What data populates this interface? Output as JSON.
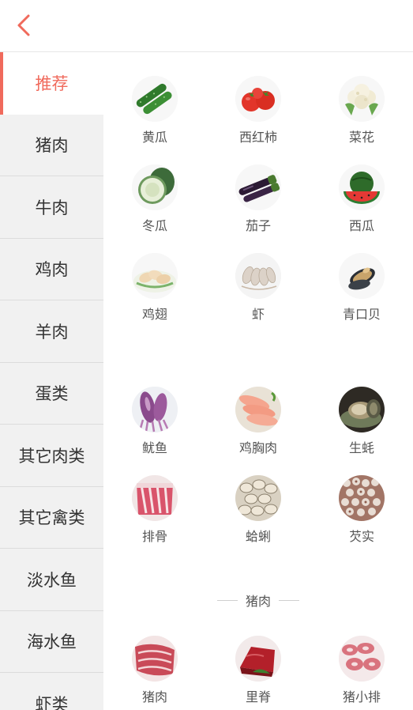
{
  "header": {
    "back_icon": "chevron-left-icon",
    "accent_color": "#f06a5c"
  },
  "sidebar": {
    "items": [
      {
        "label": "推荐",
        "active": true
      },
      {
        "label": "猪肉"
      },
      {
        "label": "牛肉"
      },
      {
        "label": "鸡肉"
      },
      {
        "label": "羊肉"
      },
      {
        "label": "蛋类"
      },
      {
        "label": "其它肉类"
      },
      {
        "label": "其它禽类"
      },
      {
        "label": "淡水鱼"
      },
      {
        "label": "海水鱼"
      },
      {
        "label": "虾类"
      }
    ]
  },
  "recommend": {
    "groups": [
      {
        "items": [
          {
            "label": "黄瓜",
            "icon": "cucumber-icon"
          },
          {
            "label": "西红柿",
            "icon": "tomato-icon"
          },
          {
            "label": "菜花",
            "icon": "cauliflower-icon"
          },
          {
            "label": "冬瓜",
            "icon": "winter-melon-icon"
          },
          {
            "label": "茄子",
            "icon": "eggplant-icon"
          },
          {
            "label": "西瓜",
            "icon": "watermelon-icon"
          },
          {
            "label": "鸡翅",
            "icon": "chicken-wing-icon"
          },
          {
            "label": "虾",
            "icon": "shrimp-icon"
          },
          {
            "label": "青口贝",
            "icon": "mussel-icon"
          }
        ]
      },
      {
        "items": [
          {
            "label": "鱿鱼",
            "icon": "squid-icon"
          },
          {
            "label": "鸡胸肉",
            "icon": "chicken-breast-icon"
          },
          {
            "label": "生蚝",
            "icon": "oyster-icon"
          },
          {
            "label": "排骨",
            "icon": "ribs-icon"
          },
          {
            "label": "蛤蜊",
            "icon": "clam-icon"
          },
          {
            "label": "芡实",
            "icon": "gorgon-seed-icon"
          }
        ]
      }
    ]
  },
  "pork_section": {
    "title": "猪肉",
    "items": [
      {
        "label": "猪肉",
        "icon": "pork-icon"
      },
      {
        "label": "里脊",
        "icon": "tenderloin-icon"
      },
      {
        "label": "猪小排",
        "icon": "pork-ribs-icon"
      }
    ]
  }
}
